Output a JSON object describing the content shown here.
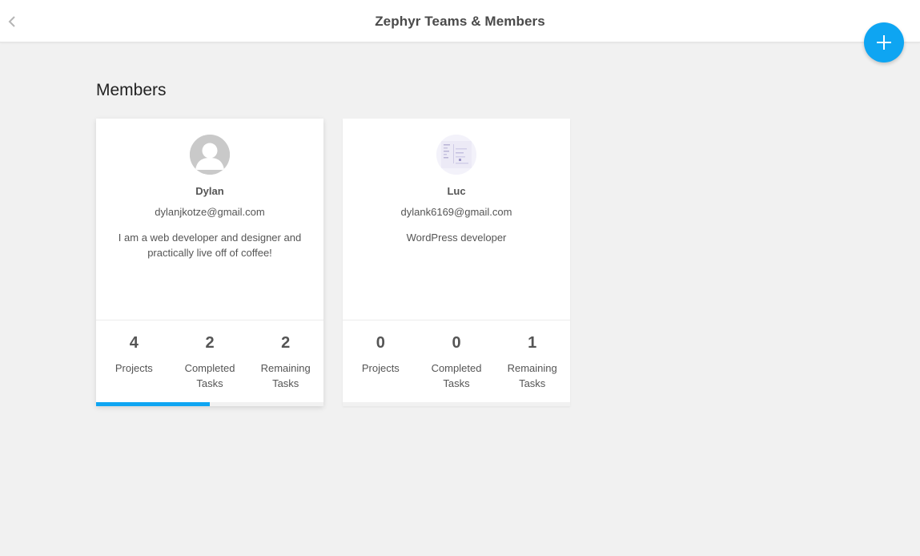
{
  "header": {
    "title": "Zephyr Teams & Members",
    "back_icon": "chevron-left-icon",
    "add_icon": "plus-icon",
    "accent_color": "#0ea5f2"
  },
  "section": {
    "heading": "Members"
  },
  "members": [
    {
      "name": "Dylan",
      "email": "dylanjkotze@gmail.com",
      "bio": "I am a web developer and designer and practically live off of coffee!",
      "avatar": "default-user-icon",
      "stats": [
        {
          "value": "4",
          "label": "Projects"
        },
        {
          "value": "2",
          "label": "Completed Tasks"
        },
        {
          "value": "2",
          "label": "Remaining Tasks"
        }
      ],
      "task_progress": 0.5
    },
    {
      "name": "Luc",
      "email": "dylank6169@gmail.com",
      "bio": "WordPress developer",
      "avatar": "profile-photo",
      "stats": [
        {
          "value": "0",
          "label": "Projects"
        },
        {
          "value": "0",
          "label": "Completed Tasks"
        },
        {
          "value": "1",
          "label": "Remaining Tasks"
        }
      ],
      "task_progress": 0
    }
  ]
}
